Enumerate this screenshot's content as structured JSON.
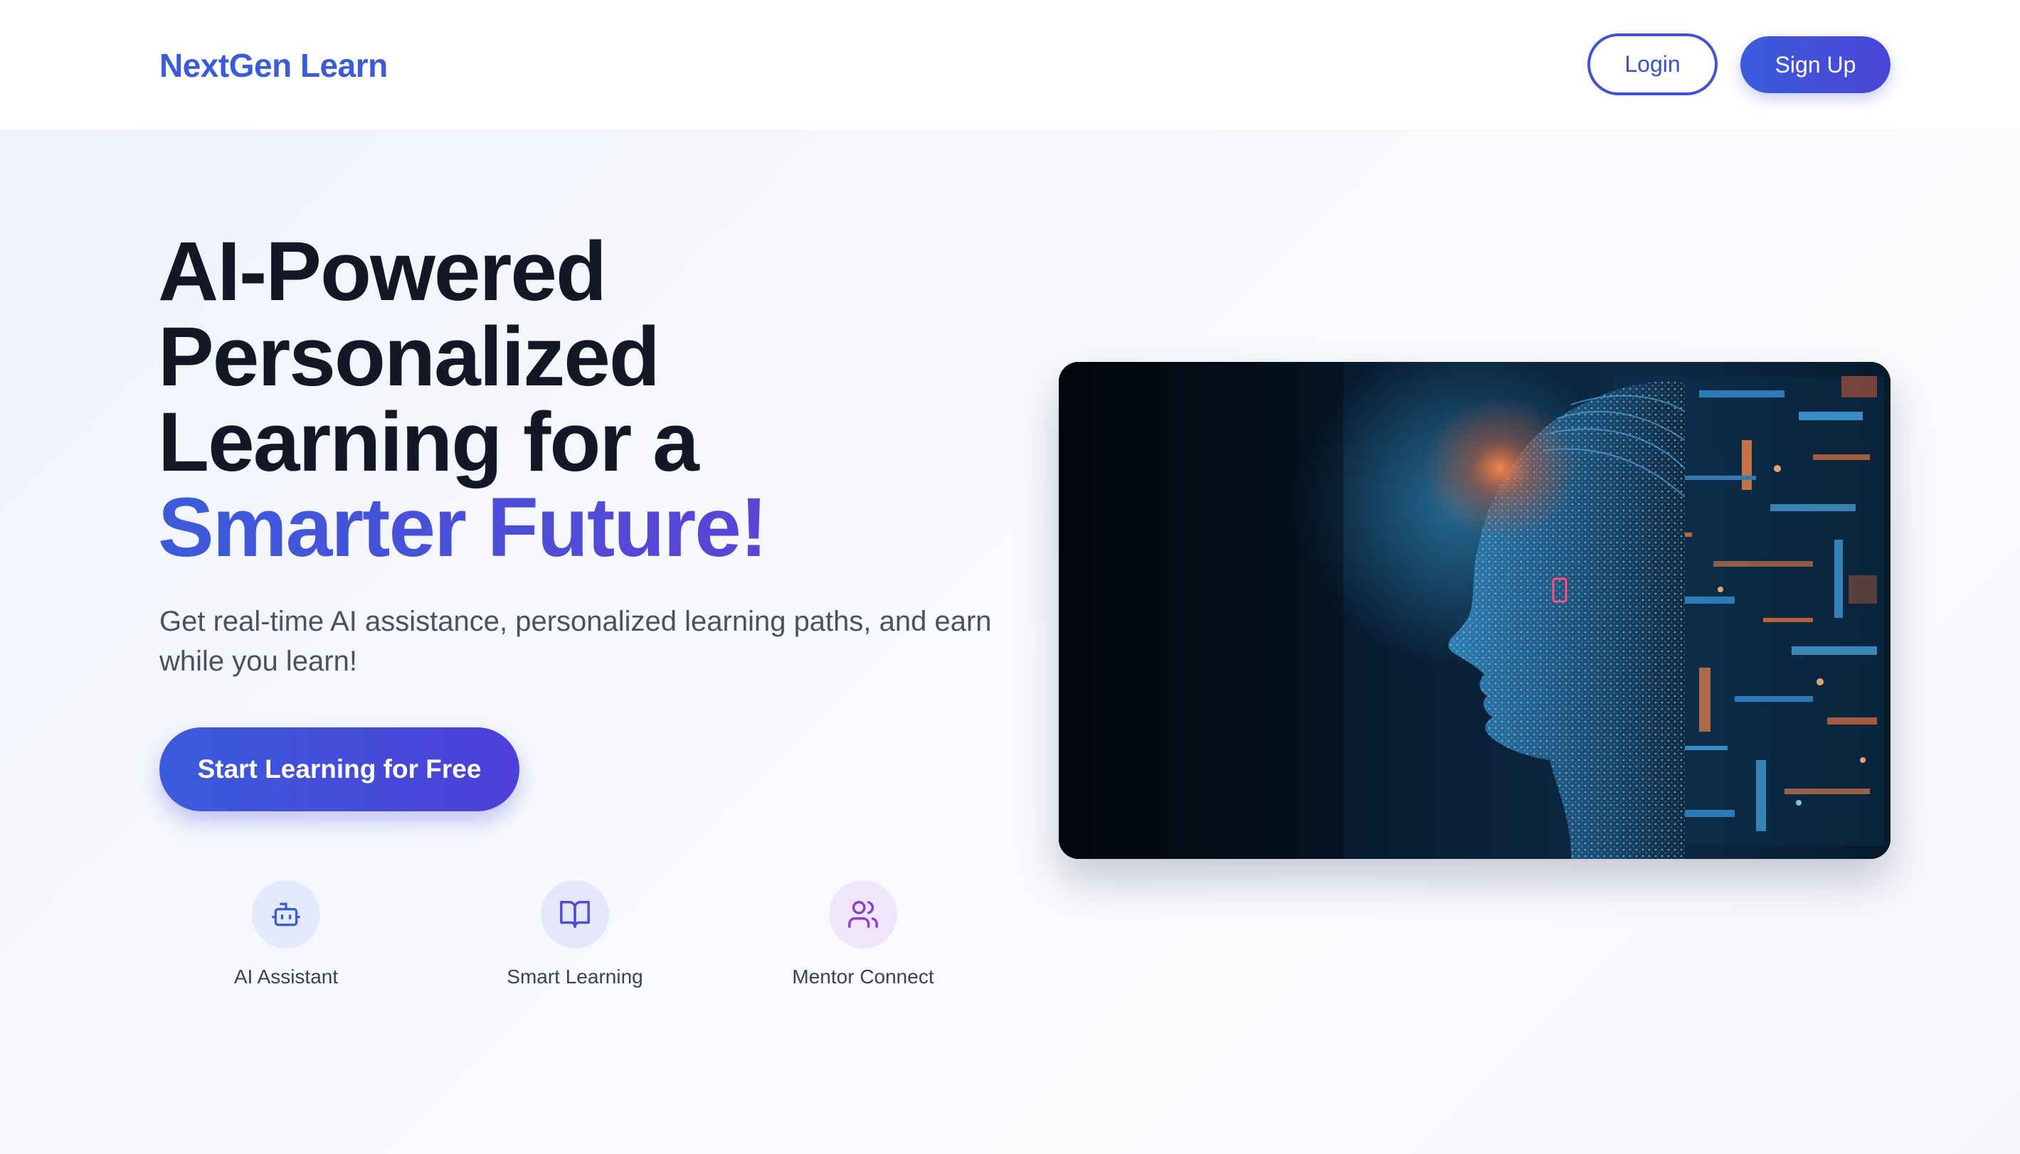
{
  "header": {
    "logo": "NextGen Learn",
    "login_label": "Login",
    "signup_label": "Sign Up"
  },
  "hero": {
    "headline_lines": [
      "AI-Powered",
      "Personalized",
      "Learning for a"
    ],
    "headline_accent": "Smarter Future!",
    "subtitle": "Get real-time AI assistance, personalized learning paths, and earn while you learn!",
    "cta_label": "Start Learning for Free"
  },
  "features": [
    {
      "label": "AI Assistant",
      "icon": "bot-icon"
    },
    {
      "label": "Smart Learning",
      "icon": "book-open-icon"
    },
    {
      "label": "Mentor Connect",
      "icon": "users-icon"
    }
  ],
  "image": {
    "subject": "ai-face-illustration"
  },
  "colors": {
    "brand": "#3b5bdb",
    "accent_gradient_end": "#5a44d6",
    "headline": "#121826",
    "body_text": "#4a5160"
  }
}
